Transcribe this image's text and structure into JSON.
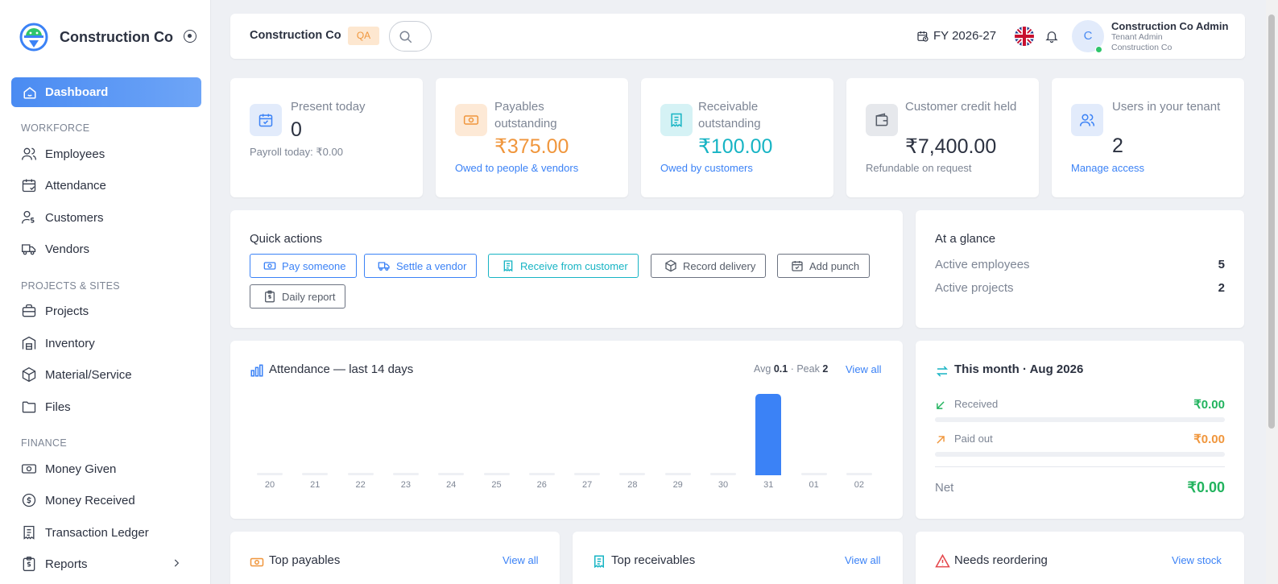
{
  "sidebar": {
    "brand_name": "Construction Co",
    "active_item": "Dashboard",
    "sections": {
      "workforce": "WORKFORCE",
      "projects": "PROJECTS & SITES",
      "finance": "FINANCE"
    },
    "items": {
      "employees": "Employees",
      "attendance": "Attendance",
      "customers": "Customers",
      "vendors": "Vendors",
      "projects": "Projects",
      "inventory": "Inventory",
      "material": "Material/Service",
      "files": "Files",
      "money_given": "Money Given",
      "money_received": "Money Received",
      "ledger": "Transaction Ledger",
      "reports": "Reports"
    }
  },
  "topbar": {
    "title": "Construction Co",
    "env_badge": "QA",
    "fiscal_year": "FY 2026-27",
    "user_initial": "C",
    "user_name": "Construction Co Admin",
    "user_role": "Tenant Admin",
    "user_org": "Construction Co"
  },
  "stats": [
    {
      "label": "Present today",
      "value": "0",
      "sub": "Payroll today: ₹0.00",
      "accent": "#3b82f6"
    },
    {
      "label": "Payables outstanding",
      "value": "₹375.00",
      "link": "Owed to people & vendors",
      "accent": "#f0963c"
    },
    {
      "label": "Receivable outstanding",
      "value": "₹100.00",
      "link": "Owed by customers",
      "accent": "#17b4c4"
    },
    {
      "label": "Customer credit held",
      "value": "₹7,400.00",
      "sub": "Refundable on request",
      "accent": "#6b7280"
    },
    {
      "label": "Users in your tenant",
      "value": "2",
      "link": "Manage access",
      "accent": "#3b82f6"
    }
  ],
  "quick_actions": {
    "title": "Quick actions",
    "buttons": [
      "Pay someone",
      "Settle a vendor",
      "Receive from customer",
      "Record delivery",
      "Add punch",
      "Daily report"
    ]
  },
  "glance": {
    "title": "At a glance",
    "rows": [
      {
        "label": "Active employees",
        "value": "5"
      },
      {
        "label": "Active projects",
        "value": "2"
      }
    ]
  },
  "attendance": {
    "title": "Attendance — last 14 days",
    "avg_label": "Avg",
    "avg_value": "0.1",
    "peak_label": "· Peak",
    "peak_value": "2",
    "view_all": "View all"
  },
  "chart_data": {
    "type": "bar",
    "categories": [
      "20",
      "21",
      "22",
      "23",
      "24",
      "25",
      "26",
      "27",
      "28",
      "29",
      "30",
      "31",
      "01",
      "02"
    ],
    "values": [
      0,
      0,
      0,
      0,
      0,
      0,
      0,
      0,
      0,
      0,
      0,
      2,
      0,
      0
    ],
    "ylim": [
      0,
      2
    ],
    "color": "#3b82f6"
  },
  "month": {
    "title": "This month · Aug 2026",
    "received_label": "Received",
    "received_value": "₹0.00",
    "paid_label": "Paid out",
    "paid_value": "₹0.00",
    "net_label": "Net",
    "net_value": "₹0.00",
    "received_color": "#22b35e",
    "paid_color": "#f0963c"
  },
  "bottom": {
    "payables_title": "Top payables",
    "payables_link": "View all",
    "receivables_title": "Top receivables",
    "receivables_link": "View all",
    "reorder_title": "Needs reordering",
    "reorder_link": "View stock"
  }
}
